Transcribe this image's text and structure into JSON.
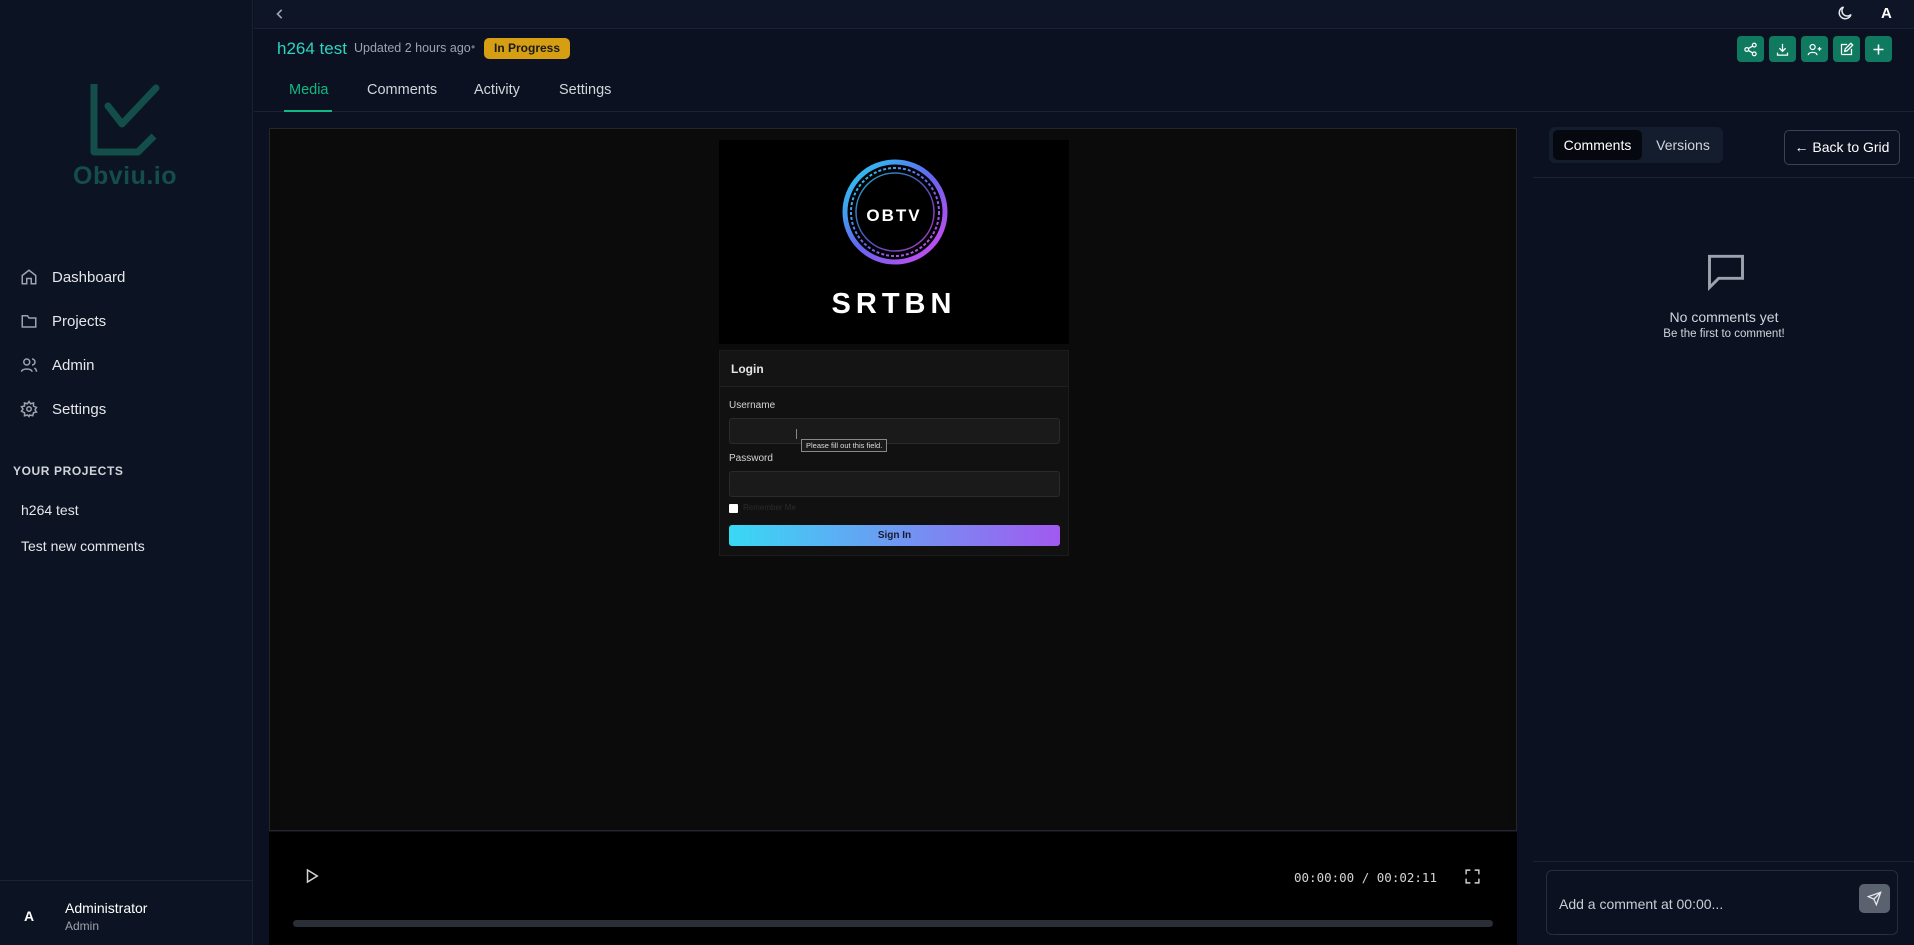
{
  "app": {
    "logo_text": "Obviu.io"
  },
  "sidebar": {
    "nav": [
      {
        "label": "Dashboard",
        "icon": "home-icon"
      },
      {
        "label": "Projects",
        "icon": "folder-icon"
      },
      {
        "label": "Admin",
        "icon": "users-icon"
      },
      {
        "label": "Settings",
        "icon": "gear-icon"
      }
    ],
    "projects_heading": "YOUR PROJECTS",
    "projects": [
      "h264 test",
      "Test new comments"
    ],
    "user": {
      "avatar": "A",
      "name": "Administrator",
      "role": "Admin"
    }
  },
  "topbar": {
    "avatar": "A",
    "icons": [
      "chevron-left-icon",
      "moon-icon"
    ]
  },
  "header": {
    "title": "h264 test",
    "updated": "Updated 2 hours ago",
    "separator": "•",
    "status": "In Progress",
    "status_color": "#d69e12",
    "actions": [
      "share-icon",
      "download-icon",
      "user-plus-icon",
      "edit-icon",
      "plus-icon"
    ],
    "action_color": "#0f7a5f"
  },
  "tabs": [
    {
      "label": "Media",
      "active": true
    },
    {
      "label": "Comments",
      "active": false
    },
    {
      "label": "Activity",
      "active": false
    },
    {
      "label": "Settings",
      "active": false
    }
  ],
  "video": {
    "frame": {
      "ring_text": "OBTV",
      "brand": "SRTBN",
      "login_title": "Login",
      "username_label": "Username",
      "tooltip": "Please fill out this field.",
      "password_label": "Password",
      "remember_label": "Remember Me",
      "signin_label": "Sign In"
    },
    "timecode": "00:00:00 / 00:02:11",
    "progress": 0
  },
  "panel": {
    "tabs": [
      "Comments",
      "Versions"
    ],
    "back_button": "← Back to Grid",
    "empty_title": "No comments yet",
    "empty_subtitle": "Be the first to comment!",
    "composer_placeholder": "Add a comment at 00:00..."
  },
  "accent": "#10b981"
}
